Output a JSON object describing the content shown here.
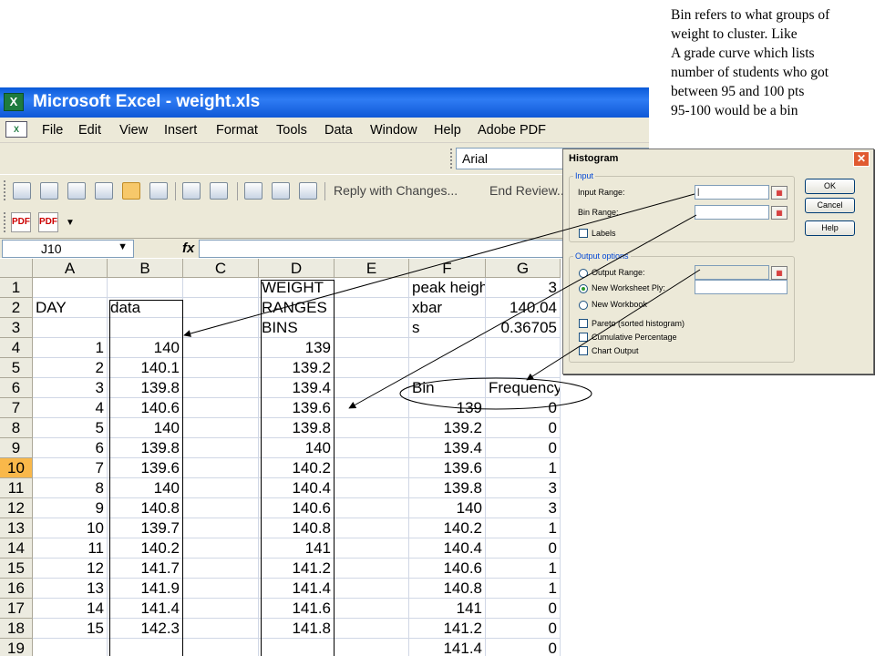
{
  "note": {
    "lines": [
      "Bin refers to what groups of",
      "weight to cluster.  Like",
      "A grade curve which lists",
      "number of students who got",
      "between 95 and 100 pts",
      "95-100 would be a bin"
    ]
  },
  "window": {
    "title": "Microsoft Excel - weight.xls"
  },
  "menu": [
    "File",
    "Edit",
    "View",
    "Insert",
    "Format",
    "Tools",
    "Data",
    "Window",
    "Help",
    "Adobe PDF"
  ],
  "font_box": "Arial",
  "toolbar": {
    "reply": "Reply with Changes...",
    "end_review": "End Review..."
  },
  "name_box": "J10",
  "fx": "fx",
  "columns": [
    "A",
    "B",
    "C",
    "D",
    "E",
    "F",
    "G"
  ],
  "active_row": "10",
  "rows": [
    {
      "n": "1",
      "A": "",
      "B": "",
      "C": "",
      "D": "WEIGHT",
      "E": "",
      "F": "peak heigh",
      "G": "3"
    },
    {
      "n": "2",
      "A": "DAY",
      "B": "data",
      "C": "",
      "D": "RANGES",
      "E": "",
      "F": "xbar",
      "G": "140.04"
    },
    {
      "n": "3",
      "A": "",
      "B": "",
      "C": "",
      "D": "BINS",
      "E": "",
      "F": "s",
      "G": "0.36705"
    },
    {
      "n": "4",
      "A": "1",
      "B": "140",
      "C": "",
      "D": "139",
      "E": "",
      "F": "",
      "G": ""
    },
    {
      "n": "5",
      "A": "2",
      "B": "140.1",
      "C": "",
      "D": "139.2",
      "E": "",
      "F": "",
      "G": ""
    },
    {
      "n": "6",
      "A": "3",
      "B": "139.8",
      "C": "",
      "D": "139.4",
      "E": "",
      "F": "Bin",
      "G": "Frequency"
    },
    {
      "n": "7",
      "A": "4",
      "B": "140.6",
      "C": "",
      "D": "139.6",
      "E": "",
      "F": "139",
      "G": "0"
    },
    {
      "n": "8",
      "A": "5",
      "B": "140",
      "C": "",
      "D": "139.8",
      "E": "",
      "F": "139.2",
      "G": "0"
    },
    {
      "n": "9",
      "A": "6",
      "B": "139.8",
      "C": "",
      "D": "140",
      "E": "",
      "F": "139.4",
      "G": "0"
    },
    {
      "n": "10",
      "A": "7",
      "B": "139.6",
      "C": "",
      "D": "140.2",
      "E": "",
      "F": "139.6",
      "G": "1"
    },
    {
      "n": "11",
      "A": "8",
      "B": "140",
      "C": "",
      "D": "140.4",
      "E": "",
      "F": "139.8",
      "G": "3"
    },
    {
      "n": "12",
      "A": "9",
      "B": "140.8",
      "C": "",
      "D": "140.6",
      "E": "",
      "F": "140",
      "G": "3"
    },
    {
      "n": "13",
      "A": "10",
      "B": "139.7",
      "C": "",
      "D": "140.8",
      "E": "",
      "F": "140.2",
      "G": "1"
    },
    {
      "n": "14",
      "A": "11",
      "B": "140.2",
      "C": "",
      "D": "141",
      "E": "",
      "F": "140.4",
      "G": "0"
    },
    {
      "n": "15",
      "A": "12",
      "B": "141.7",
      "C": "",
      "D": "141.2",
      "E": "",
      "F": "140.6",
      "G": "1"
    },
    {
      "n": "16",
      "A": "13",
      "B": "141.9",
      "C": "",
      "D": "141.4",
      "E": "",
      "F": "140.8",
      "G": "1"
    },
    {
      "n": "17",
      "A": "14",
      "B": "141.4",
      "C": "",
      "D": "141.6",
      "E": "",
      "F": "141",
      "G": "0"
    },
    {
      "n": "18",
      "A": "15",
      "B": "142.3",
      "C": "",
      "D": "141.8",
      "E": "",
      "F": "141.2",
      "G": "0"
    },
    {
      "n": "19",
      "A": "",
      "B": "",
      "C": "",
      "D": "",
      "E": "",
      "F": "141.4",
      "G": "0"
    }
  ],
  "dialog": {
    "title": "Histogram",
    "input_group": "Input",
    "input_range_label": "Input Range:",
    "input_range_value": "|",
    "bin_range_label": "Bin Range:",
    "labels_label": "Labels",
    "output_group": "Output options",
    "output_range_label": "Output Range:",
    "new_ply_label": "New Worksheet Ply:",
    "new_workbook_label": "New Workbook",
    "pareto_label": "Pareto (sorted histogram)",
    "cumulative_label": "Cumulative Percentage",
    "chart_label": "Chart Output",
    "ok": "OK",
    "cancel": "Cancel",
    "help": "Help"
  }
}
